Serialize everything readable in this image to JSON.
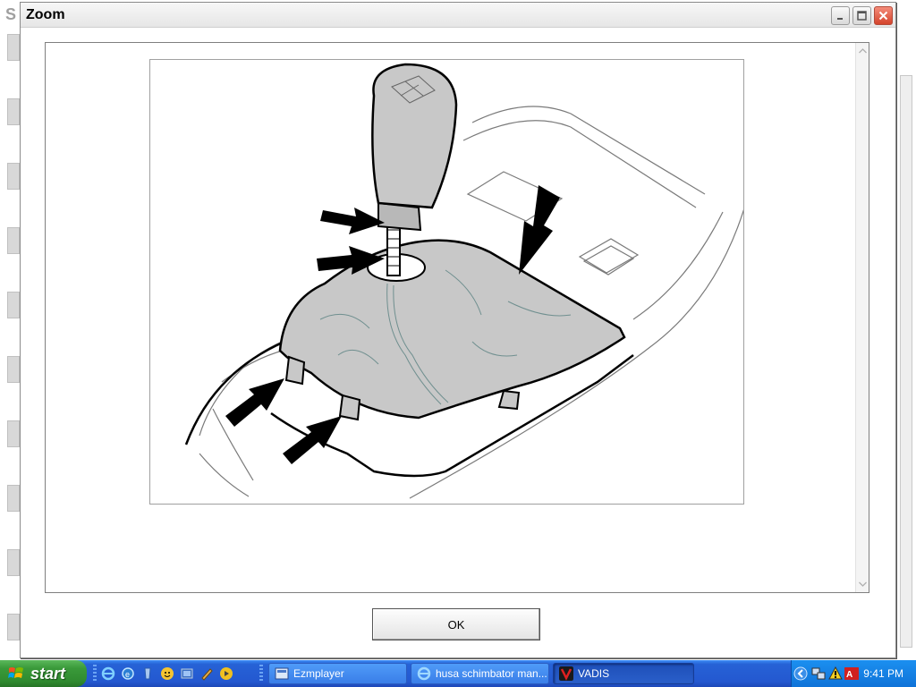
{
  "dialog": {
    "title": "Zoom",
    "ok_label": "OK"
  },
  "background_app": {
    "title_fragment": "S"
  },
  "taskbar": {
    "start_label": "start",
    "quick_launch": [
      "internet-explorer-icon",
      "ie-alt-icon",
      "media-icon",
      "messenger-icon",
      "media-player-icon",
      "paint-icon",
      "player-icon"
    ],
    "tasks": [
      {
        "label": "Ezmplayer",
        "icon": "ezmplayer-icon",
        "active": false
      },
      {
        "label": "husa schimbator man...",
        "icon": "internet-explorer-icon",
        "active": false
      },
      {
        "label": "VADIS",
        "icon": "vadis-icon",
        "active": true
      }
    ],
    "clock": "9:41 PM"
  },
  "colors": {
    "taskbar": "#245edb",
    "start": "#3a9a3a",
    "boot_fill": "#c8c8c8"
  }
}
